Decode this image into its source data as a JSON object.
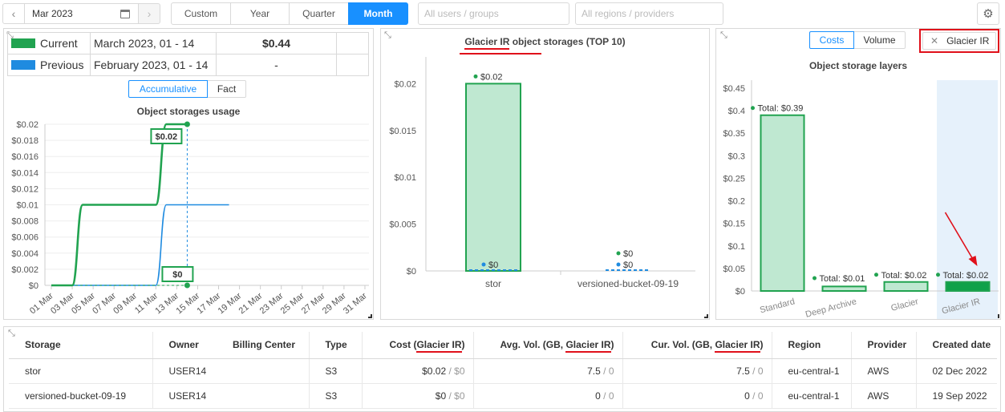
{
  "toolbar": {
    "date": "Mar 2023",
    "periods": [
      "Custom",
      "Year",
      "Quarter",
      "Month"
    ],
    "active_period": "Month",
    "users_placeholder": "All users / groups",
    "regions_placeholder": "All regions / providers"
  },
  "summary": {
    "rows": [
      {
        "label": "Current",
        "range": "March 2023, 01 - 14",
        "value": "$0.44",
        "color": "#21a350"
      },
      {
        "label": "Previous",
        "range": "February 2023, 01 - 14",
        "value": "-",
        "color": "#1f8be0"
      }
    ]
  },
  "usage_chart": {
    "toggle": [
      "Accumulative",
      "Fact"
    ],
    "active_toggle": "Accumulative",
    "title": "Object storages usage",
    "tooltip_top": "$0.02",
    "tooltip_bottom": "$0"
  },
  "colors": {
    "current": "#21a350",
    "previous": "#1f8be0",
    "accent": "#1890ff",
    "highlight": "#e0101a"
  },
  "top10_chart": {
    "title_pre": "Glacier IR",
    "title_post": " object storages (TOP 10)"
  },
  "layers_chart": {
    "toggle": [
      "Costs",
      "Volume"
    ],
    "active_toggle": "Costs",
    "filter_tag": "Glacier IR",
    "title": "Object storage layers"
  },
  "chart_data": [
    {
      "type": "line",
      "title": "Object storages usage",
      "x": [
        "01 Mar",
        "03 Mar",
        "05 Mar",
        "07 Mar",
        "09 Mar",
        "11 Mar",
        "13 Mar",
        "15 Mar",
        "17 Mar",
        "19 Mar",
        "21 Mar",
        "23 Mar",
        "25 Mar",
        "27 Mar",
        "29 Mar",
        "31 Mar"
      ],
      "yticks": [
        "$0",
        "$0.002",
        "$0.004",
        "$0.006",
        "$0.008",
        "$0.01",
        "$0.012",
        "$0.014",
        "$0.016",
        "$0.018",
        "$0.02"
      ],
      "ylim": [
        0,
        0.02
      ],
      "series": [
        {
          "name": "Current",
          "points": [
            [
              1,
              0
            ],
            [
              2,
              0
            ],
            [
              3,
              0
            ],
            [
              4,
              0.01
            ],
            [
              5,
              0.01
            ],
            [
              6,
              0.01
            ],
            [
              7,
              0.01
            ],
            [
              8,
              0.01
            ],
            [
              9,
              0.01
            ],
            [
              10,
              0.01
            ],
            [
              11,
              0.01
            ],
            [
              12,
              0.02
            ],
            [
              13,
              0.02
            ],
            [
              14,
              0.02
            ]
          ]
        },
        {
          "name": "Previous",
          "points": [
            [
              1,
              0
            ],
            [
              11,
              0
            ],
            [
              12,
              0.01
            ],
            [
              13,
              0.01
            ],
            [
              14,
              0.01
            ],
            [
              15,
              0.01
            ],
            [
              16,
              0.01
            ],
            [
              17,
              0.01
            ],
            [
              18,
              0.01
            ]
          ]
        }
      ]
    },
    {
      "type": "bar",
      "title": "Glacier IR object storages (TOP 10)",
      "categories": [
        "stor",
        "versioned-bucket-09-19"
      ],
      "series": [
        {
          "name": "Current",
          "values": [
            0.02,
            0
          ]
        },
        {
          "name": "Previous",
          "values": [
            0,
            0
          ]
        }
      ],
      "value_labels_current": [
        "$0.02",
        "$0"
      ],
      "value_labels_previous": [
        "$0",
        "$0"
      ],
      "yticks": [
        "$0",
        "$0.005",
        "$0.01",
        "$0.015",
        "$0.02"
      ],
      "ylim": [
        0,
        0.022
      ]
    },
    {
      "type": "bar",
      "title": "Object storage layers",
      "categories": [
        "Standard",
        "Deep Archive",
        "Glacier",
        "Glacier IR"
      ],
      "values": [
        0.39,
        0.01,
        0.02,
        0.02
      ],
      "value_labels": [
        "Total: $0.39",
        "Total: $0.01",
        "Total: $0.02",
        "Total: $0.02"
      ],
      "selected": "Glacier IR",
      "yticks": [
        "$0",
        "$0.05",
        "$0.1",
        "$0.15",
        "$0.2",
        "$0.25",
        "$0.3",
        "$0.35",
        "$0.4",
        "$0.45"
      ],
      "ylim": [
        0,
        0.45
      ]
    }
  ],
  "table": {
    "headers": [
      "Storage",
      "Owner",
      "Billing Center",
      "Type",
      "Cost (",
      "Glacier IR",
      ")",
      "Avg. Vol. (GB, ",
      "Glacier IR",
      ")",
      "Cur. Vol. (GB, ",
      "Glacier IR",
      ")",
      "Region",
      "Provider",
      "Created date"
    ],
    "rows": [
      {
        "storage": "stor",
        "owner": "USER14",
        "billing": "",
        "type": "S3",
        "cost": "$0.02",
        "cost_prev": "$0",
        "avg": "7.5",
        "avg_prev": "0",
        "cur": "7.5",
        "cur_prev": "0",
        "region": "eu-central-1",
        "provider": "AWS",
        "created": "02 Dec 2022"
      },
      {
        "storage": "versioned-bucket-09-19",
        "owner": "USER14",
        "billing": "",
        "type": "S3",
        "cost": "$0",
        "cost_prev": "$0",
        "avg": "0",
        "avg_prev": "0",
        "cur": "0",
        "cur_prev": "0",
        "region": "eu-central-1",
        "provider": "AWS",
        "created": "19 Sep 2022"
      }
    ],
    "sep": " / "
  }
}
